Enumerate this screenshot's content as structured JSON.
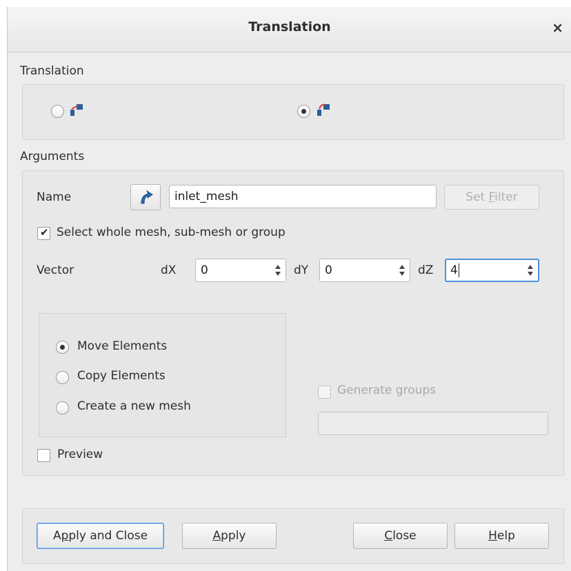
{
  "window": {
    "title": "Translation",
    "close_glyph": "×"
  },
  "translation": {
    "label": "Translation",
    "mode_options": [
      {
        "icon": "two-points-icon",
        "selected": false
      },
      {
        "icon": "vector-icon",
        "selected": true
      }
    ]
  },
  "arguments": {
    "label": "Arguments",
    "name_label": "Name",
    "name_selection_icon": "select-object-icon",
    "name_value": "inlet_mesh",
    "set_filter_prefix": "Set ",
    "set_filter_mnemonic": "F",
    "set_filter_suffix": "ilter",
    "whole_mesh_label": "Select whole mesh, sub-mesh or group",
    "whole_mesh_checked": true,
    "vector_label": "Vector",
    "dx_label": "dX",
    "dx_value": "0",
    "dy_label": "dY",
    "dy_value": "0",
    "dz_label": "dZ",
    "dz_value": "4",
    "operations": [
      {
        "label": "Move Elements",
        "selected": true
      },
      {
        "label": "Copy Elements",
        "selected": false
      },
      {
        "label": "Create a new mesh",
        "selected": false
      }
    ],
    "generate_groups_label": "Generate groups",
    "generate_groups_checked": false,
    "new_mesh_name_value": "",
    "preview_label": "Preview",
    "preview_checked": false
  },
  "buttons": {
    "apply_close_pre": "A",
    "apply_close_mn": "p",
    "apply_close_post": "ply and Close",
    "apply_mn": "A",
    "apply_post": "pply",
    "close_mn": "C",
    "close_post": "lose",
    "help_mn": "H",
    "help_post": "elp"
  },
  "colors": {
    "accent": "#4a90d9",
    "dialog_bg": "#ededed",
    "icon_blue": "#2b6cb0"
  }
}
